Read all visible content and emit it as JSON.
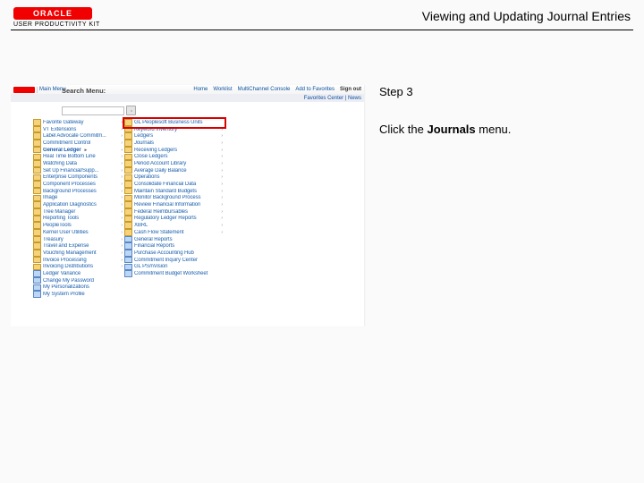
{
  "brand": {
    "logo_text": "ORACLE",
    "product": "USER PRODUCTIVITY KIT"
  },
  "page_title": "Viewing and Updating Journal Entries",
  "step": {
    "label": "Step 3",
    "text_before": "Click the ",
    "text_bold": "Journals",
    "text_after": " menu."
  },
  "app": {
    "search_title": "Search Menu:",
    "breadcrumb_left": "Favorites Center  |  News",
    "header_links": {
      "main": "Main Menu"
    },
    "header_right": [
      "Home",
      "Worklist",
      "MultiChannel Console",
      "Add to Favorites",
      "Sign out"
    ],
    "left_menu": [
      "Favorite Gateway",
      "VT Extensions",
      "Label Advocate Commitm...",
      "Commitment Control",
      "General Ledger",
      "Real Time Bottom Line",
      "Watching Data",
      "Set Up Financial/Supp...",
      "Enterprise Components",
      "Component Processes",
      "Background Processes",
      "Image",
      "Application Diagnostics",
      "Tree Manager",
      "Reporting Tools",
      "PeopleTools",
      "Kernel User Utilities",
      "Treasury",
      "Travel and Expense",
      "Vouching Management",
      "Invoice Processing",
      "Invoicing Distributions",
      "Ledger Variance",
      "Change My Password",
      "My Personalizations",
      "My System Profile"
    ],
    "right_menu_header": "GL Peoplesoft Business Units",
    "right_menu": [
      "Keyword Inventory",
      "Ledgers",
      "Journals",
      "Receiving Ledgers",
      "Close Ledgers",
      "Period Account Library",
      "Average Daily Balance",
      "Operations",
      "Consolidate Financial Data",
      "Maintain Standard Budgets",
      "Monitor Background Process",
      "Review Financial Information",
      "Federal Reimbursables",
      "Regulatory Ledger Reports",
      "XBRL",
      "Cash Flow Statement",
      "General Reports",
      "Financial Reports",
      "Purchase Accounting Hub",
      "Commitment Inquiry Center",
      "GL PS/nVision",
      "Commitment Budget Worksheet"
    ],
    "highlight_target": "Journals"
  }
}
